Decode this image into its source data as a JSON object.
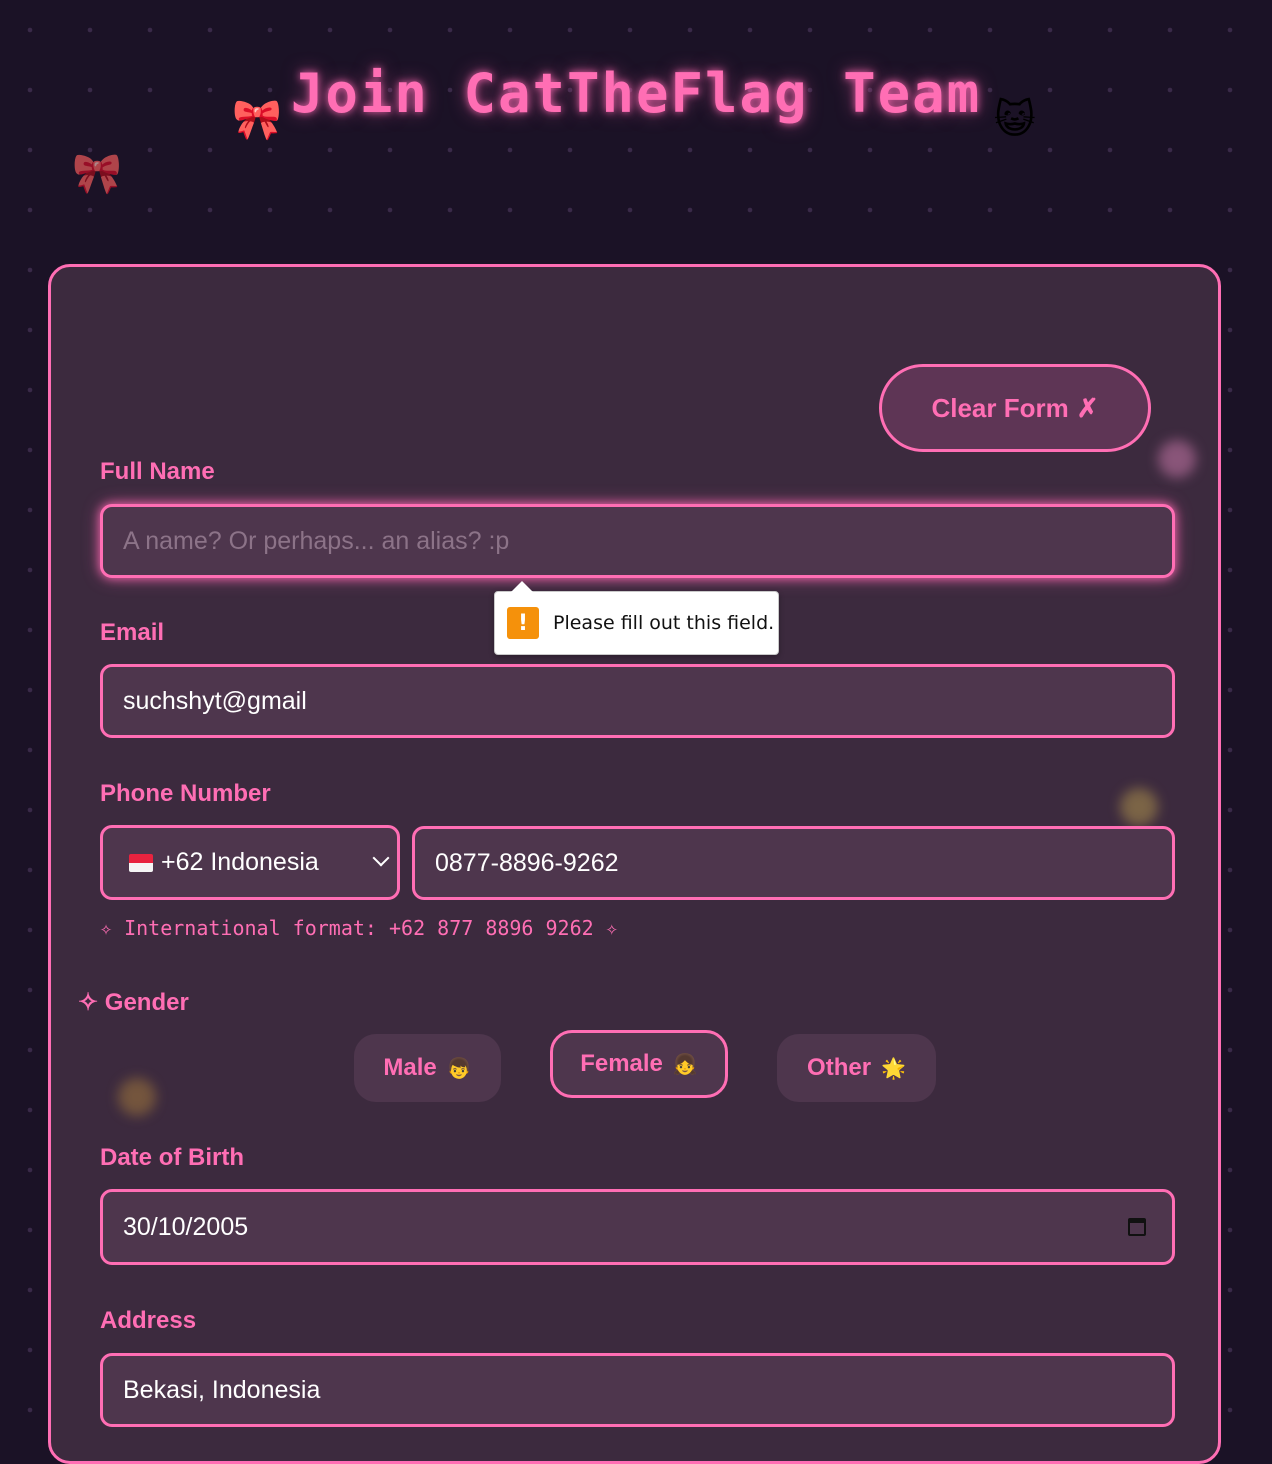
{
  "header": {
    "title": "Join CatTheFlag Team",
    "decorations": {
      "bow_left": "🎀",
      "bow_far": "🎀",
      "cat": "😺"
    }
  },
  "form": {
    "clear_button": {
      "label": "Clear Form",
      "icon": "✗"
    },
    "full_name": {
      "label": "Full Name",
      "value": "",
      "placeholder": "A name? Or perhaps... an alias? :p"
    },
    "validation_tooltip": {
      "icon": "!",
      "message": "Please fill out this field."
    },
    "email": {
      "label": "Email",
      "value": "suchshyt@gmail"
    },
    "phone": {
      "label": "Phone Number",
      "country_flag": "indonesia-flag",
      "country_value": "+62 Indonesia",
      "number_value": "0877-8896-9262",
      "hint": "✧ International format: +62 877 8896 9262 ✧"
    },
    "gender": {
      "label": "✧ Gender",
      "options": [
        {
          "label": "Male",
          "emoji": "👦"
        },
        {
          "label": "Female",
          "emoji": "👧"
        },
        {
          "label": "Other",
          "emoji": "🌟"
        }
      ],
      "selected": "Female"
    },
    "dob": {
      "label": "Date of Birth",
      "value": "30/10/2005"
    },
    "address": {
      "label": "Address",
      "value": "Bekasi, Indonesia"
    }
  },
  "colors": {
    "accent": "#ff6eb4",
    "background": "#1b1226",
    "card": "#3c2a3e",
    "field": "#4e364d"
  }
}
